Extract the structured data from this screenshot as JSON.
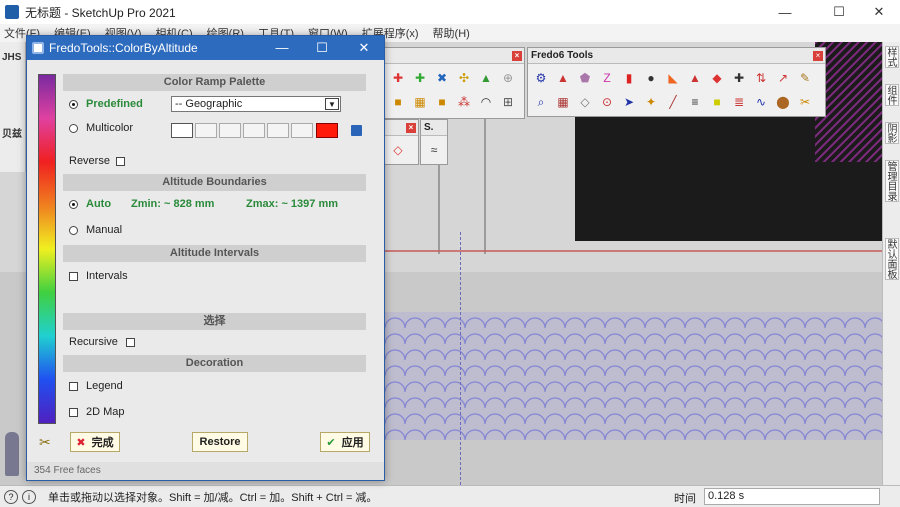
{
  "app": {
    "window_title": "无标题 - SketchUp Pro 2021",
    "minimize": "—",
    "maximize": "☐",
    "close": "✕"
  },
  "menubar": [
    "文件(F)",
    "编辑(E)",
    "视图(V)",
    "相机(C)",
    "绘图(R)",
    "工具(T)",
    "窗口(W)",
    "扩展程序(x)",
    "帮助(H)"
  ],
  "left_toolbars": {
    "jhs": "JHS",
    "beiyi": "贝兹"
  },
  "fredo6_toolbar": {
    "title": "Fredo6 Tools"
  },
  "right_tray_tabs": [
    "样式",
    "组件",
    "阴影",
    "管理目录",
    "默认面板"
  ],
  "dialog": {
    "title": "FredoTools::ColorByAltitude",
    "minimize": "—",
    "maximize": "☐",
    "close": "✕",
    "sections": {
      "color_ramp": "Color Ramp Palette",
      "altitude_boundaries": "Altitude Boundaries",
      "altitude_intervals": "Altitude Intervals",
      "select": "选择",
      "decoration": "Decoration"
    },
    "predefined_label": "Predefined",
    "predefined_value": "-- Geographic",
    "multicolor_label": "Multicolor",
    "reverse_label": "Reverse",
    "auto_label": "Auto",
    "zmin_label": "Zmin: ~ 828 mm",
    "zmax_label": "Zmax: ~ 1397 mm",
    "manual_label": "Manual",
    "intervals_label": "Intervals",
    "recursive_label": "Recursive",
    "legend_label": "Legend",
    "map2d_label": "2D Map",
    "done_button": "完成",
    "restore_button": "Restore",
    "apply_button": "应用",
    "footer_status": "354 Free faces",
    "swatch_colors": [
      "#ffffff",
      "#f4f4f4",
      "#f4f4f4",
      "#f4f4f4",
      "#f4f4f4",
      "#f4f4f4",
      "#ff1a0a"
    ]
  },
  "statusbar": {
    "hint": "单击或拖动以选择对象。Shift = 加/减。Ctrl = 加。Shift + Ctrl = 减。",
    "time_label": "时间",
    "time_value": "0.128 s"
  }
}
